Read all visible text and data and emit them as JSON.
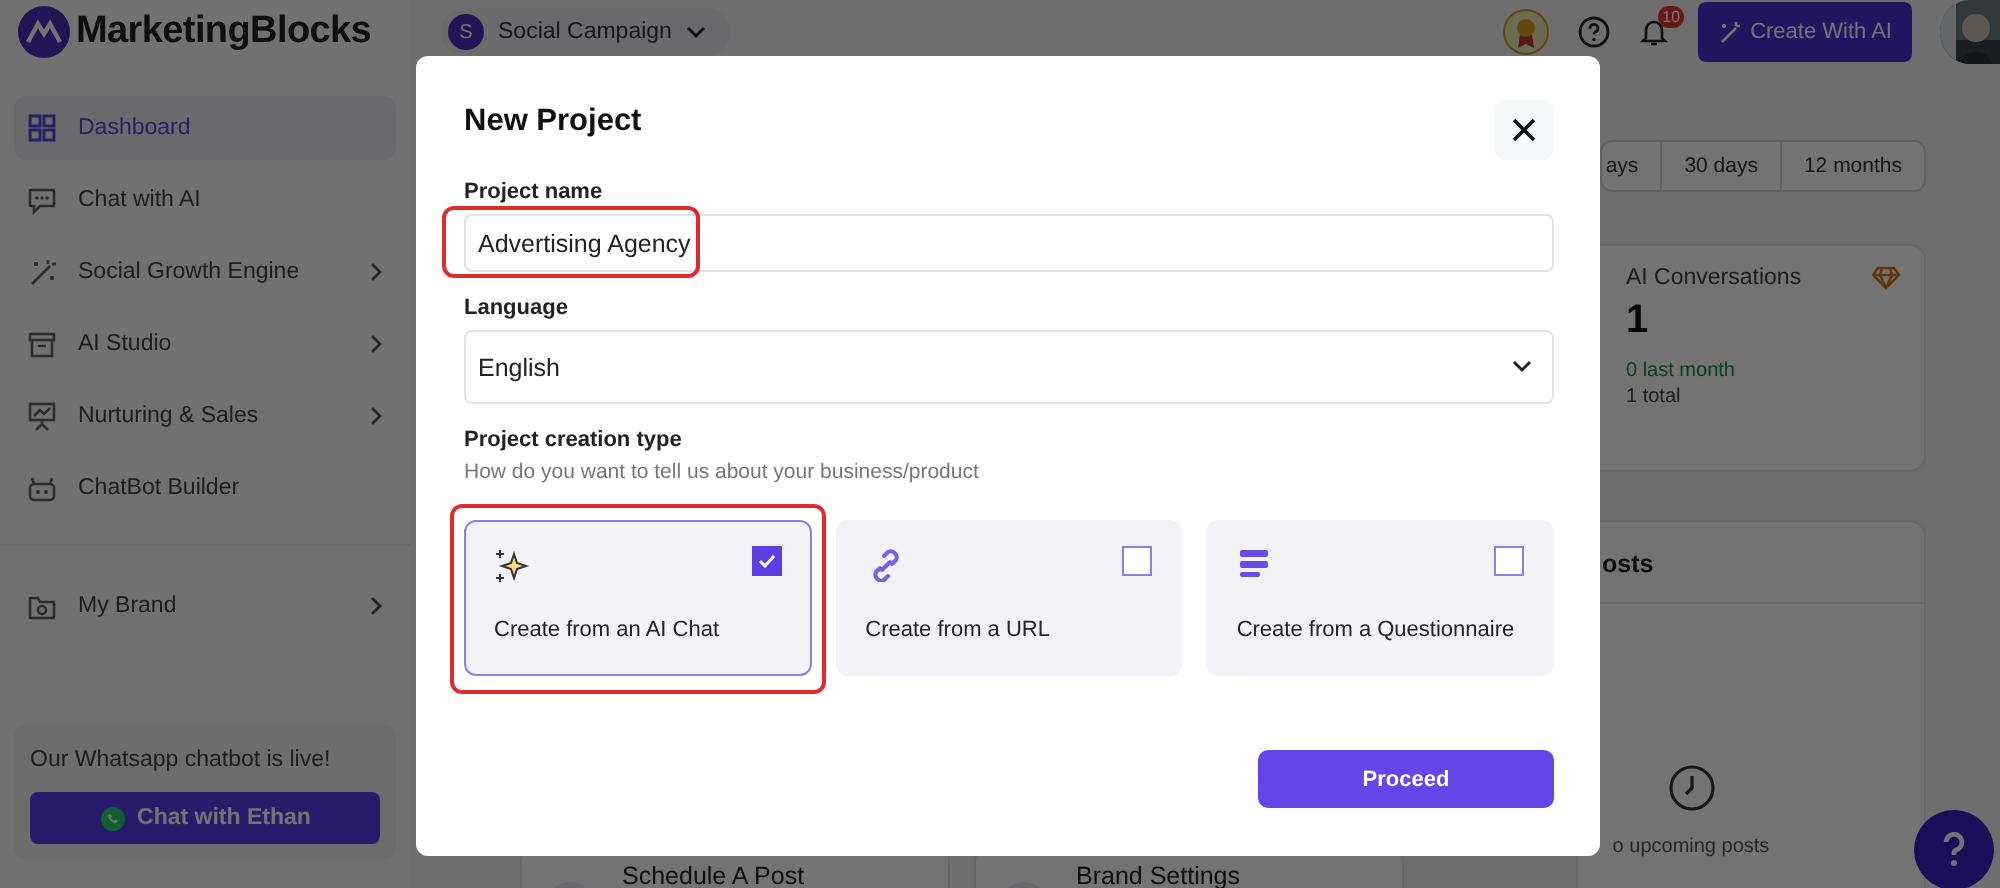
{
  "topbar": {
    "logo": "MarketingBlocks",
    "workspace": {
      "initial": "S",
      "name": "Social Campaign"
    },
    "notification_count": "10",
    "create_button": "Create With AI"
  },
  "sidebar": {
    "items": [
      {
        "label": "Dashboard",
        "kind": "grid",
        "selected": true,
        "has_submenu": false
      },
      {
        "label": "Chat with AI",
        "kind": "chat",
        "selected": false,
        "has_submenu": false
      },
      {
        "label": "Social Growth Engine",
        "kind": "wand",
        "selected": false,
        "has_submenu": true
      },
      {
        "label": "AI Studio",
        "kind": "archive",
        "selected": false,
        "has_submenu": true
      },
      {
        "label": "Nurturing & Sales",
        "kind": "board",
        "selected": false,
        "has_submenu": true
      },
      {
        "label": "ChatBot Builder",
        "kind": "robot",
        "selected": false,
        "has_submenu": false
      },
      {
        "label": "My Brand",
        "kind": "folder",
        "selected": false,
        "has_submenu": true
      }
    ],
    "promo": {
      "text": "Our Whatsapp chatbot is live!",
      "button": "Chat with Ethan"
    }
  },
  "dashboard": {
    "range_tabs": [
      {
        "label": "ays",
        "selected": false
      },
      {
        "label": "30 days",
        "selected": false
      },
      {
        "label": "12 months",
        "selected": false
      }
    ],
    "stat_card": {
      "title": "AI Conversations",
      "value": "1",
      "change": "0 last month",
      "total": "1 total"
    },
    "posts_card": {
      "title": "osts",
      "empty_text": "o upcoming posts"
    },
    "quick_actions": [
      "Schedule A Post",
      "Brand Settings"
    ]
  },
  "modal": {
    "title": "New Project",
    "fields": [
      {
        "kind": "text",
        "label": "Project name",
        "value": "Advertising Agency",
        "highlighted": true
      },
      {
        "kind": "select",
        "label": "Language",
        "value": "English",
        "highlighted": false
      }
    ],
    "creation_type": {
      "label": "Project creation type",
      "hint": "How do you want to tell us about your business/product",
      "options": [
        {
          "kind": "ai_chat",
          "label": "Create from an AI Chat",
          "selected": true,
          "highlighted": true
        },
        {
          "kind": "url",
          "label": "Create from a URL",
          "selected": false,
          "highlighted": false
        },
        {
          "kind": "questionnaire",
          "label": "Create from a Questionnaire",
          "selected": false,
          "highlighted": false
        }
      ]
    },
    "proceed_button": "Proceed"
  }
}
